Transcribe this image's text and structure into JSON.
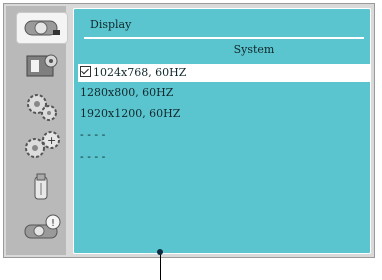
{
  "sidebar": {
    "items": [
      {
        "icon": "projector-icon",
        "active": true
      },
      {
        "icon": "picture-settings-icon",
        "active": false
      },
      {
        "icon": "gear-icon",
        "active": false
      },
      {
        "icon": "advanced-gear-icon",
        "active": false
      },
      {
        "icon": "usb-icon",
        "active": false
      },
      {
        "icon": "projector-info-icon",
        "active": false
      }
    ]
  },
  "panel": {
    "title": "Display",
    "section": "System",
    "options": [
      {
        "label": "1024x768, 60HZ",
        "selected": true
      },
      {
        "label": "1280x800, 60HZ",
        "selected": false
      },
      {
        "label": "1920x1200, 60HZ",
        "selected": false
      },
      {
        "label": "-   -   -   -",
        "selected": false
      },
      {
        "label": "-   -   -   -",
        "selected": false
      }
    ]
  },
  "colors": {
    "panel_bg": "#5bc5cf",
    "sidebar_bg": "#b9b9b9",
    "frame_bg": "#d9d9d9",
    "highlight": "#ffffff"
  }
}
